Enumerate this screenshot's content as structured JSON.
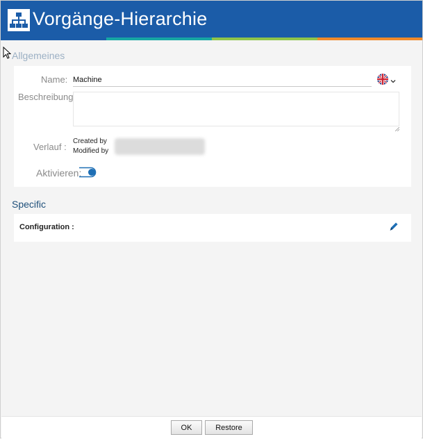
{
  "window": {
    "title": "Vorgänge-Hierarchie"
  },
  "general": {
    "section_title": "Allgemeines",
    "name_label": "Name:",
    "name_value": "Machine",
    "description_label": "Beschreibung:",
    "description_value": "",
    "history_label": "Verlauf :",
    "created_by_label": "Created by",
    "modified_by_label": "Modified by",
    "activate_label": "Aktivieren:",
    "activate_on": true
  },
  "specific": {
    "section_title": "Specific",
    "configuration_label": "Configuration :"
  },
  "footer": {
    "ok_label": "OK",
    "restore_label": "Restore"
  },
  "icons": [
    "hierarchy-icon",
    "uk-flag-icon",
    "chevron-down-icon",
    "pencil-icon",
    "cursor-icon"
  ],
  "colors": {
    "header": "#1b5ca8",
    "stripe_teal": "#16a7a3",
    "stripe_green": "#8fc54a",
    "stripe_orange": "#f08a2a",
    "accent": "#1e6fb5"
  }
}
